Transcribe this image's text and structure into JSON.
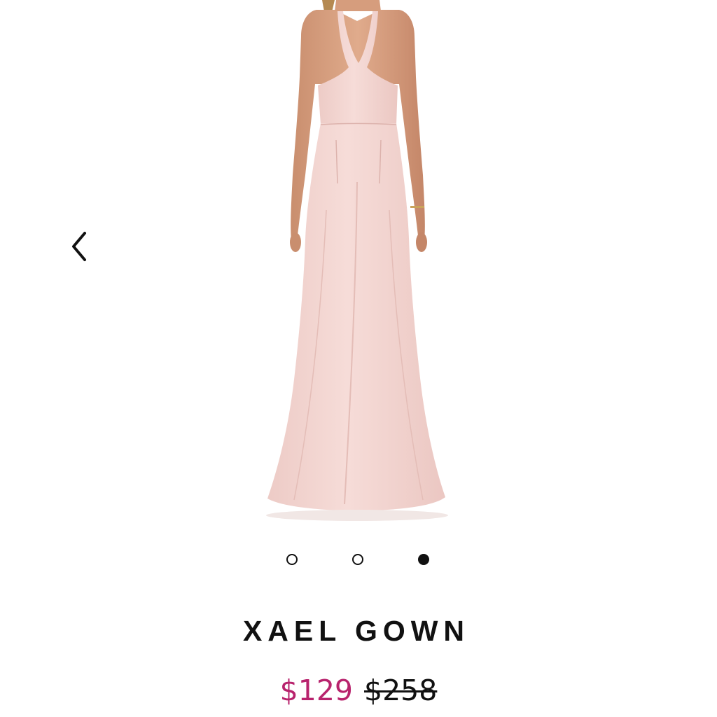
{
  "product": {
    "name": "XAEL GOWN",
    "sale_price": "$129",
    "original_price": "$258",
    "image_subject": "blush pink racerback maxi gown, back view",
    "dress_color": "#f3d6d2"
  },
  "carousel": {
    "prev_icon": "chevron-left-icon",
    "total_slides": 3,
    "active_slide": 3
  },
  "colors": {
    "sale_price": "#b8236d",
    "text": "#111111",
    "background": "#ffffff"
  }
}
